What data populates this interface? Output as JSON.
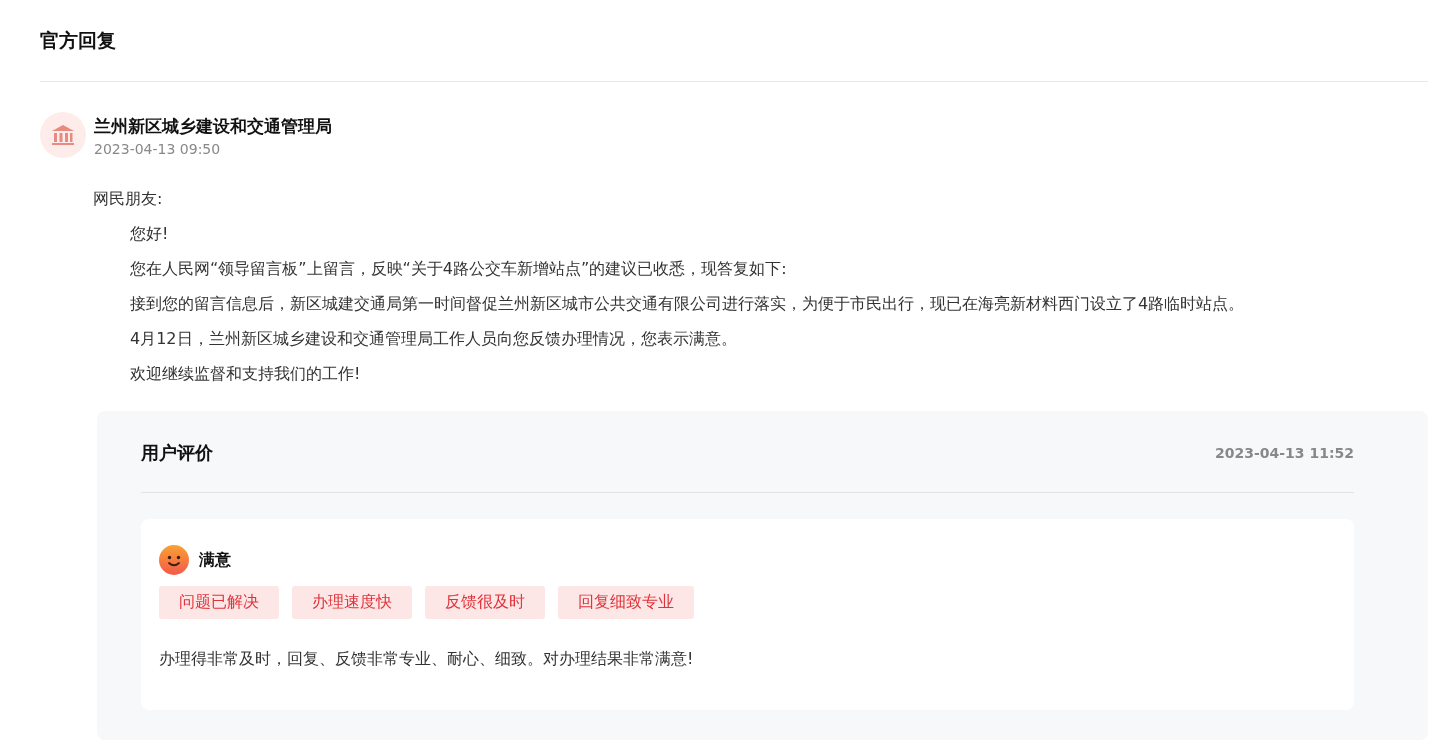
{
  "section_title": "官方回复",
  "reply": {
    "author": "兰州新区城乡建设和交通管理局",
    "time": "2023-04-13 09:50",
    "salutation": "网民朋友:",
    "paragraphs": [
      "您好!",
      "您在人民网“领导留言板”上留言，反映“关于4路公交车新增站点”的建议已收悉，现答复如下:",
      "接到您的留言信息后，新区城建交通局第一时间督促兰州新区城市公共交通有限公司进行落实，为便于市民出行，现已在海亮新材料西门设立了4路临时站点。",
      "4月12日，兰州新区城乡建设和交通管理局工作人员向您反馈办理情况，您表示满意。",
      "欢迎继续监督和支持我们的工作!"
    ]
  },
  "evaluation": {
    "title": "用户评价",
    "time": "2023-04-13 11:52",
    "rating": "满意",
    "tags": [
      "问题已解决",
      "办理速度快",
      "反馈很及时",
      "回复细致专业"
    ],
    "comment": "办理得非常及时，回复、反馈非常专业、耐心、细致。对办理结果非常满意!"
  }
}
